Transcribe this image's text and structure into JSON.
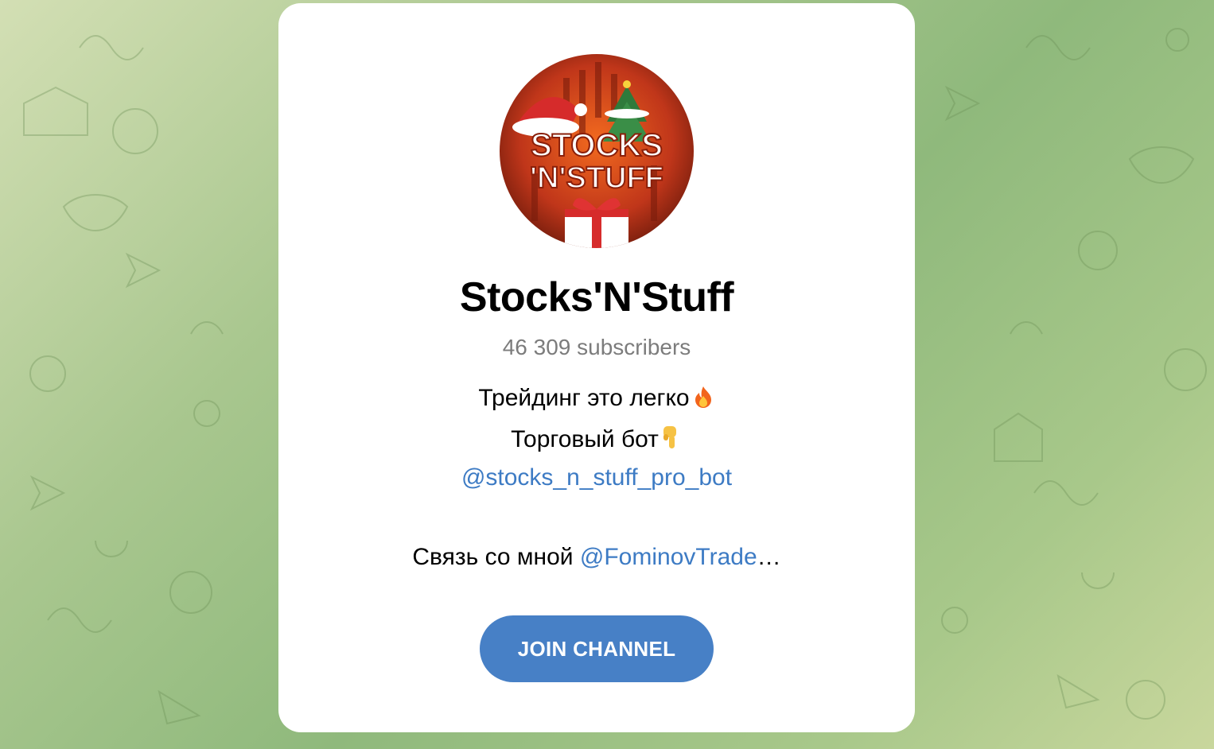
{
  "channel": {
    "title": "Stocks'N'Stuff",
    "subscribers": "46 309 subscribers",
    "avatar_text_line1": "STOCKS",
    "avatar_text_line2": "'N'STUFF"
  },
  "description": {
    "line1_text": "Трейдинг это легко",
    "line1_emoji": "fire-icon",
    "line2_text": "Торговый бот",
    "line2_emoji": "pointing-down-icon",
    "bot_link": "@stocks_n_stuff_pro_bot",
    "contact_prefix": "Связь со мной ",
    "contact_link": "@FominovTrade",
    "contact_ellipsis": "…"
  },
  "actions": {
    "join_label": "JOIN CHANNEL"
  },
  "colors": {
    "accent": "#4780c6",
    "link": "#3d7bc4",
    "muted_text": "#7c7c7c",
    "background_green": "#a9c78f"
  }
}
